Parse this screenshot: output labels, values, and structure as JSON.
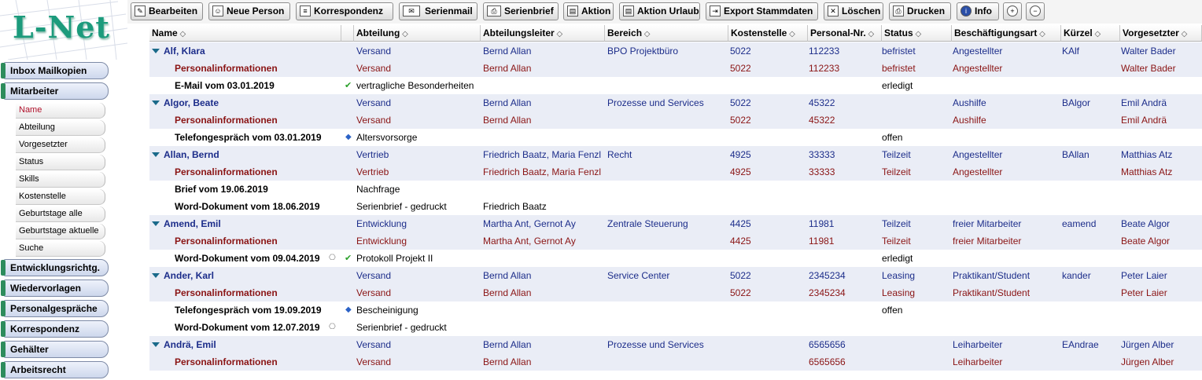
{
  "app": {
    "logo": "L-Net"
  },
  "nav": {
    "items": [
      {
        "label": "Inbox Mailkopien"
      },
      {
        "label": "Mitarbeiter"
      },
      {
        "label": "Entwicklungsrichtg."
      },
      {
        "label": "Wiedervorlagen"
      },
      {
        "label": "Personalgespräche"
      },
      {
        "label": "Korrespondenz"
      },
      {
        "label": "Gehälter"
      },
      {
        "label": "Arbeitsrecht"
      }
    ],
    "subitems": [
      {
        "label": "Name"
      },
      {
        "label": "Abteilung"
      },
      {
        "label": "Vorgesetzter"
      },
      {
        "label": "Status"
      },
      {
        "label": "Skills"
      },
      {
        "label": "Kostenstelle"
      },
      {
        "label": "Geburtstage alle"
      },
      {
        "label": "Geburtstage aktuelle"
      },
      {
        "label": "Suche"
      }
    ]
  },
  "toolbar": {
    "buttons": [
      {
        "label": "Bearbeiten",
        "icon": "edit-icon"
      },
      {
        "label": "Neue Person",
        "icon": "person-icon"
      },
      {
        "label": "Korrespondenz",
        "icon": "document-icon"
      },
      {
        "label": "Serienmail",
        "icon": "mail-icon"
      },
      {
        "label": "Serienbrief",
        "icon": "letter-icon"
      },
      {
        "label": "Aktion",
        "icon": "action-icon"
      },
      {
        "label": "Aktion Urlaub",
        "icon": "vacation-icon"
      },
      {
        "label": "Export Stammdaten",
        "icon": "export-icon"
      },
      {
        "label": "Löschen",
        "icon": "delete-icon"
      },
      {
        "label": "Drucken",
        "icon": "print-icon"
      },
      {
        "label": "Info",
        "icon": "info-icon"
      },
      {
        "label": "",
        "icon": "expand-icon"
      },
      {
        "label": "",
        "icon": "collapse-icon"
      }
    ]
  },
  "grid": {
    "columns": [
      "Name",
      "Abteilung",
      "Abteilungsleiter",
      "Bereich",
      "Kostenstelle",
      "Personal-Nr.",
      "Status",
      "Beschäftigungsart",
      "Kürzel",
      "Vorgesetzter"
    ],
    "sort_glyph": "◇",
    "rows": [
      {
        "type": "person",
        "name": "Alf, Klara",
        "abteilung": "Versand",
        "leiter": "Bernd Allan",
        "bereich": "BPO Projektbüro",
        "kst": "5022",
        "pnr": "112233",
        "status": "befristet",
        "art": "Angestellter",
        "kuerzel": "KAlf",
        "vorg": "Walter Bader"
      },
      {
        "type": "pinfo",
        "name": "Personalinformationen",
        "abteilung": "Versand",
        "leiter": "Bernd Allan",
        "bereich": "",
        "kst": "5022",
        "pnr": "112233",
        "status": "befristet",
        "art": "Angestellter",
        "kuerzel": "",
        "vorg": "Walter Bader"
      },
      {
        "type": "act",
        "name": "E-Mail vom 03.01.2019",
        "mark": "ok",
        "abteilung": "vertragliche Besonderheiten",
        "leiter": "",
        "bereich": "",
        "kst": "",
        "pnr": "",
        "status": "erledigt",
        "art": "",
        "kuerzel": "",
        "vorg": ""
      },
      {
        "type": "person",
        "name": "Algor, Beate",
        "abteilung": "Versand",
        "leiter": "Bernd Allan",
        "bereich": "Prozesse und Services",
        "kst": "5022",
        "pnr": "45322",
        "status": "",
        "art": "Aushilfe",
        "kuerzel": "BAlgor",
        "vorg": "Emil Andrä"
      },
      {
        "type": "pinfo",
        "name": "Personalinformationen",
        "abteilung": "Versand",
        "leiter": "Bernd Allan",
        "bereich": "",
        "kst": "5022",
        "pnr": "45322",
        "status": "",
        "art": "Aushilfe",
        "kuerzel": "",
        "vorg": "Emil Andrä"
      },
      {
        "type": "act",
        "name": "Telefongespräch vom 03.01.2019",
        "mark": "dia",
        "abteilung": "Altersvorsorge",
        "leiter": "",
        "bereich": "",
        "kst": "",
        "pnr": "",
        "status": "offen",
        "art": "",
        "kuerzel": "",
        "vorg": ""
      },
      {
        "type": "person",
        "name": "Allan, Bernd",
        "abteilung": "Vertrieb",
        "leiter": "Friedrich Baatz, Maria Fenzl",
        "bereich": "Recht",
        "kst": "4925",
        "pnr": "33333",
        "status": "Teilzeit",
        "art": "Angestellter",
        "kuerzel": "BAllan",
        "vorg": "Matthias Atz"
      },
      {
        "type": "pinfo",
        "name": "Personalinformationen",
        "abteilung": "Vertrieb",
        "leiter": "Friedrich Baatz, Maria Fenzl",
        "bereich": "",
        "kst": "4925",
        "pnr": "33333",
        "status": "Teilzeit",
        "art": "Angestellter",
        "kuerzel": "",
        "vorg": "Matthias Atz"
      },
      {
        "type": "act",
        "name": "Brief vom 19.06.2019",
        "mark": "",
        "abteilung": "Nachfrage",
        "leiter": "",
        "bereich": "",
        "kst": "",
        "pnr": "",
        "status": "",
        "art": "",
        "kuerzel": "",
        "vorg": ""
      },
      {
        "type": "act",
        "name": "Word-Dokument vom 18.06.2019",
        "mark": "",
        "abteilung": "Serienbrief - gedruckt",
        "leiter": "Friedrich Baatz",
        "bereich": "",
        "kst": "",
        "pnr": "",
        "status": "",
        "art": "",
        "kuerzel": "",
        "vorg": ""
      },
      {
        "type": "person",
        "name": "Amend, Emil",
        "abteilung": "Entwicklung",
        "leiter": "Martha Ant, Gernot Ay",
        "bereich": "Zentrale Steuerung",
        "kst": "4425",
        "pnr": "11981",
        "status": "Teilzeit",
        "art": "freier Mitarbeiter",
        "kuerzel": "eamend",
        "vorg": "Beate Algor"
      },
      {
        "type": "pinfo",
        "name": "Personalinformationen",
        "abteilung": "Entwicklung",
        "leiter": "Martha Ant, Gernot Ay",
        "bereich": "",
        "kst": "4425",
        "pnr": "11981",
        "status": "Teilzeit",
        "art": "freier Mitarbeiter",
        "kuerzel": "",
        "vorg": "Beate Algor"
      },
      {
        "type": "act",
        "name": "Word-Dokument vom 09.04.2019",
        "mark": "lockok",
        "abteilung": "Protokoll Projekt II",
        "leiter": "",
        "bereich": "",
        "kst": "",
        "pnr": "",
        "status": "erledigt",
        "art": "",
        "kuerzel": "",
        "vorg": ""
      },
      {
        "type": "person",
        "name": "Ander, Karl",
        "abteilung": "Versand",
        "leiter": "Bernd Allan",
        "bereich": "Service Center",
        "kst": "5022",
        "pnr": "2345234",
        "status": "Leasing",
        "art": "Praktikant/Student",
        "kuerzel": "kander",
        "vorg": "Peter Laier"
      },
      {
        "type": "pinfo",
        "name": "Personalinformationen",
        "abteilung": "Versand",
        "leiter": "Bernd Allan",
        "bereich": "",
        "kst": "5022",
        "pnr": "2345234",
        "status": "Leasing",
        "art": "Praktikant/Student",
        "kuerzel": "",
        "vorg": "Peter Laier"
      },
      {
        "type": "act",
        "name": "Telefongespräch vom 19.09.2019",
        "mark": "dia",
        "abteilung": "Bescheinigung",
        "leiter": "",
        "bereich": "",
        "kst": "",
        "pnr": "",
        "status": "offen",
        "art": "",
        "kuerzel": "",
        "vorg": ""
      },
      {
        "type": "act",
        "name": "Word-Dokument vom 12.07.2019",
        "mark": "lock",
        "abteilung": "Serienbrief - gedruckt",
        "leiter": "",
        "bereich": "",
        "kst": "",
        "pnr": "",
        "status": "",
        "art": "",
        "kuerzel": "",
        "vorg": ""
      },
      {
        "type": "person",
        "name": "Andrä, Emil",
        "abteilung": "Versand",
        "leiter": "Bernd Allan",
        "bereich": "Prozesse und Services",
        "kst": "",
        "pnr": "6565656",
        "status": "",
        "art": "Leiharbeiter",
        "kuerzel": "EAndrae",
        "vorg": "Jürgen Alber"
      },
      {
        "type": "pinfo",
        "name": "Personalinformationen",
        "abteilung": "Versand",
        "leiter": "Bernd Allan",
        "bereich": "",
        "kst": "",
        "pnr": "6565656",
        "status": "",
        "art": "Leiharbeiter",
        "kuerzel": "",
        "vorg": "Jürgen Alber"
      }
    ]
  }
}
